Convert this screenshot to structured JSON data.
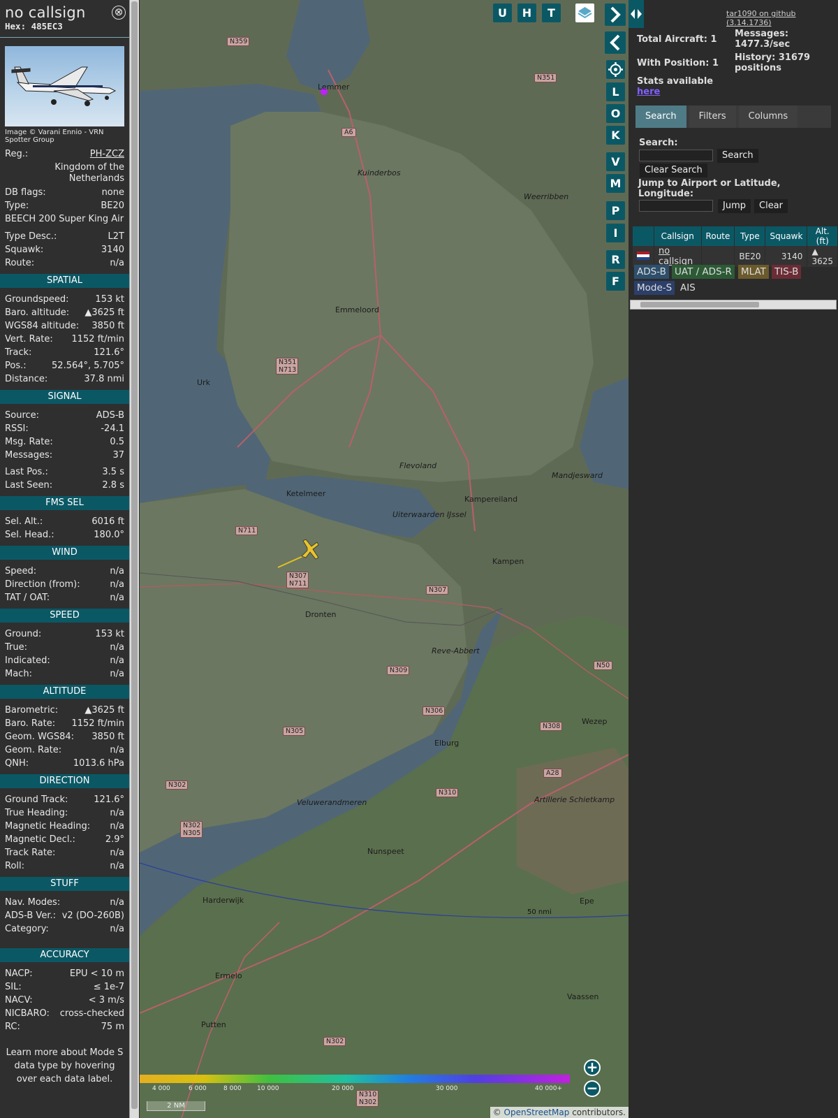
{
  "sidebar": {
    "callsign": "no callsign",
    "hex": "Hex: 485EC3",
    "close": "⊗",
    "photo_credit": "Image © Varani Ennio - VRN Spotter Group",
    "info": [
      {
        "label": "Reg.:",
        "value": "PH-ZCZ"
      },
      {
        "label": "",
        "value": "Kingdom of the Netherlands"
      },
      {
        "label": "DB flags:",
        "value": "none"
      },
      {
        "label": "Type:",
        "value": "BE20"
      },
      {
        "label": "BEECH 200 Super King Air",
        "value": ""
      },
      {
        "label": "Type Desc.:",
        "value": "L2T"
      },
      {
        "label": "Squawk:",
        "value": "3140"
      },
      {
        "label": "Route:",
        "value": "n/a"
      }
    ],
    "spatial": {
      "title": "SPATIAL",
      "rows": [
        {
          "label": "Groundspeed:",
          "value": "153 kt"
        },
        {
          "label": "Baro. altitude:",
          "value": "▲3625 ft"
        },
        {
          "label": "WGS84 altitude:",
          "value": "3850 ft"
        },
        {
          "label": "Vert. Rate:",
          "value": "1152 ft/min"
        },
        {
          "label": "Track:",
          "value": "121.6°"
        },
        {
          "label": "Pos.:",
          "value": "52.564°, 5.705°"
        },
        {
          "label": "Distance:",
          "value": "37.8 nmi"
        }
      ]
    },
    "signal": {
      "title": "SIGNAL",
      "rows": [
        {
          "label": "Source:",
          "value": "ADS-B"
        },
        {
          "label": "RSSI:",
          "value": "-24.1"
        },
        {
          "label": "Msg. Rate:",
          "value": "0.5"
        },
        {
          "label": "Messages:",
          "value": "37"
        },
        {
          "label": "Last Pos.:",
          "value": "3.5 s"
        },
        {
          "label": "Last Seen:",
          "value": "2.8 s"
        }
      ]
    },
    "fms": {
      "title": "FMS SEL",
      "rows": [
        {
          "label": "Sel. Alt.:",
          "value": "6016 ft"
        },
        {
          "label": "Sel. Head.:",
          "value": "180.0°"
        }
      ]
    },
    "wind": {
      "title": "WIND",
      "rows": [
        {
          "label": "Speed:",
          "value": "n/a"
        },
        {
          "label": "Direction (from):",
          "value": "n/a"
        },
        {
          "label": "TAT / OAT:",
          "value": "n/a"
        }
      ]
    },
    "speed": {
      "title": "SPEED",
      "rows": [
        {
          "label": "Ground:",
          "value": "153 kt"
        },
        {
          "label": "True:",
          "value": "n/a"
        },
        {
          "label": "Indicated:",
          "value": "n/a"
        },
        {
          "label": "Mach:",
          "value": "n/a"
        }
      ]
    },
    "altitude": {
      "title": "ALTITUDE",
      "rows": [
        {
          "label": "Barometric:",
          "value": "▲3625 ft"
        },
        {
          "label": "Baro. Rate:",
          "value": "1152 ft/min"
        },
        {
          "label": "Geom. WGS84:",
          "value": "3850 ft"
        },
        {
          "label": "Geom. Rate:",
          "value": "n/a"
        },
        {
          "label": "QNH:",
          "value": "1013.6 hPa"
        }
      ]
    },
    "direction": {
      "title": "DIRECTION",
      "rows": [
        {
          "label": "Ground Track:",
          "value": "121.6°"
        },
        {
          "label": "True Heading:",
          "value": "n/a"
        },
        {
          "label": "Magnetic Heading:",
          "value": "n/a"
        },
        {
          "label": "Magnetic Decl.:",
          "value": "2.9°"
        },
        {
          "label": "Track Rate:",
          "value": "n/a"
        },
        {
          "label": "Roll:",
          "value": "n/a"
        }
      ]
    },
    "stuff": {
      "title": "STUFF",
      "rows": [
        {
          "label": "Nav. Modes:",
          "value": "n/a"
        },
        {
          "label": "ADS-B Ver.:",
          "value": "v2 (DO-260B)"
        },
        {
          "label": "Category:",
          "value": "n/a"
        }
      ]
    },
    "accuracy": {
      "title": "ACCURACY",
      "rows": [
        {
          "label": "NACP:",
          "value": "EPU < 10 m"
        },
        {
          "label": "SIL:",
          "value": "≤ 1e-7"
        },
        {
          "label": "NACV:",
          "value": "< 3 m/s"
        },
        {
          "label": "NICBARO:",
          "value": "cross-checked"
        },
        {
          "label": "RC:",
          "value": "75 m"
        }
      ]
    },
    "note": "Learn more about Mode S data type by hovering over each data label."
  },
  "map": {
    "places": [
      {
        "name": "Lemmer"
      },
      {
        "name": "Emmeloord"
      },
      {
        "name": "Urk"
      },
      {
        "name": "Ketelmeer"
      },
      {
        "name": "Kampereiland"
      },
      {
        "name": "Kampen"
      },
      {
        "name": "Dronten"
      },
      {
        "name": "Elburg"
      },
      {
        "name": "Nunspeet"
      },
      {
        "name": "Harderwijk"
      },
      {
        "name": "Ermelo"
      },
      {
        "name": "Putten"
      },
      {
        "name": "Vaassen"
      },
      {
        "name": "Epe"
      },
      {
        "name": "Wezep"
      },
      {
        "name": "Weerribben"
      },
      {
        "name": "Kuinderbos"
      },
      {
        "name": "Flevoland"
      },
      {
        "name": "Veluwerandmeren"
      },
      {
        "name": "Artillerie Schietkamp"
      },
      {
        "name": "Mandjesward"
      },
      {
        "name": "Uiterwaarden IJssel"
      },
      {
        "name": "Reve-Abbert"
      }
    ],
    "roads": [
      "N359",
      "N351",
      "A6",
      "N351 N713",
      "N711",
      "N307 N711",
      "N307",
      "N309",
      "N306",
      "N305",
      "N302",
      "N302 N305",
      "N310",
      "N308",
      "A28",
      "N50",
      "N302",
      "N310 N302"
    ],
    "scale_label": "50 nmi",
    "scale_bar": "2 NM",
    "legend": [
      "4 000",
      "6 000",
      "8 000",
      "10 000",
      "20 000",
      "30 000",
      "40 000+"
    ],
    "attribution_prefix": "©",
    "attribution_link": "OpenStreetMap",
    "attribution_suffix": "contributors.",
    "zoom_in": "+",
    "zoom_out": "−"
  },
  "overlay_buttons": {
    "u": "U",
    "h": "H",
    "t": "T",
    "side": [
      "L",
      "O",
      "K",
      "V",
      "M",
      "P",
      "I",
      "R",
      "F"
    ]
  },
  "right": {
    "github": "tar1090 on github (3.14.1736)",
    "total_aircraft": "Total Aircraft: 1",
    "with_position": "With Position: 1",
    "messages": "Messages: 1477.3/sec",
    "history": "History: 31679 positions",
    "stats_text": "Stats available",
    "stats_link": "here",
    "tabs": [
      "Search",
      "Filters",
      "Columns"
    ],
    "search_label": "Search:",
    "search_btn": "Search",
    "clear_search_btn": "Clear Search",
    "jump_label": "Jump to Airport or Latitude, Longitude:",
    "jump_btn": "Jump",
    "clear_btn": "Clear",
    "table": {
      "headers": [
        "",
        "Callsign",
        "Route",
        "Type",
        "Squawk",
        "Alt. (ft)"
      ],
      "row": {
        "callsign": "no callsign",
        "route": "",
        "type": "BE20",
        "squawk": "3140",
        "alt": "▲ 3625"
      }
    },
    "sources": [
      "ADS-B",
      "UAT / ADS-R",
      "MLAT",
      "TIS-B",
      "Mode-S",
      "AIS"
    ]
  }
}
